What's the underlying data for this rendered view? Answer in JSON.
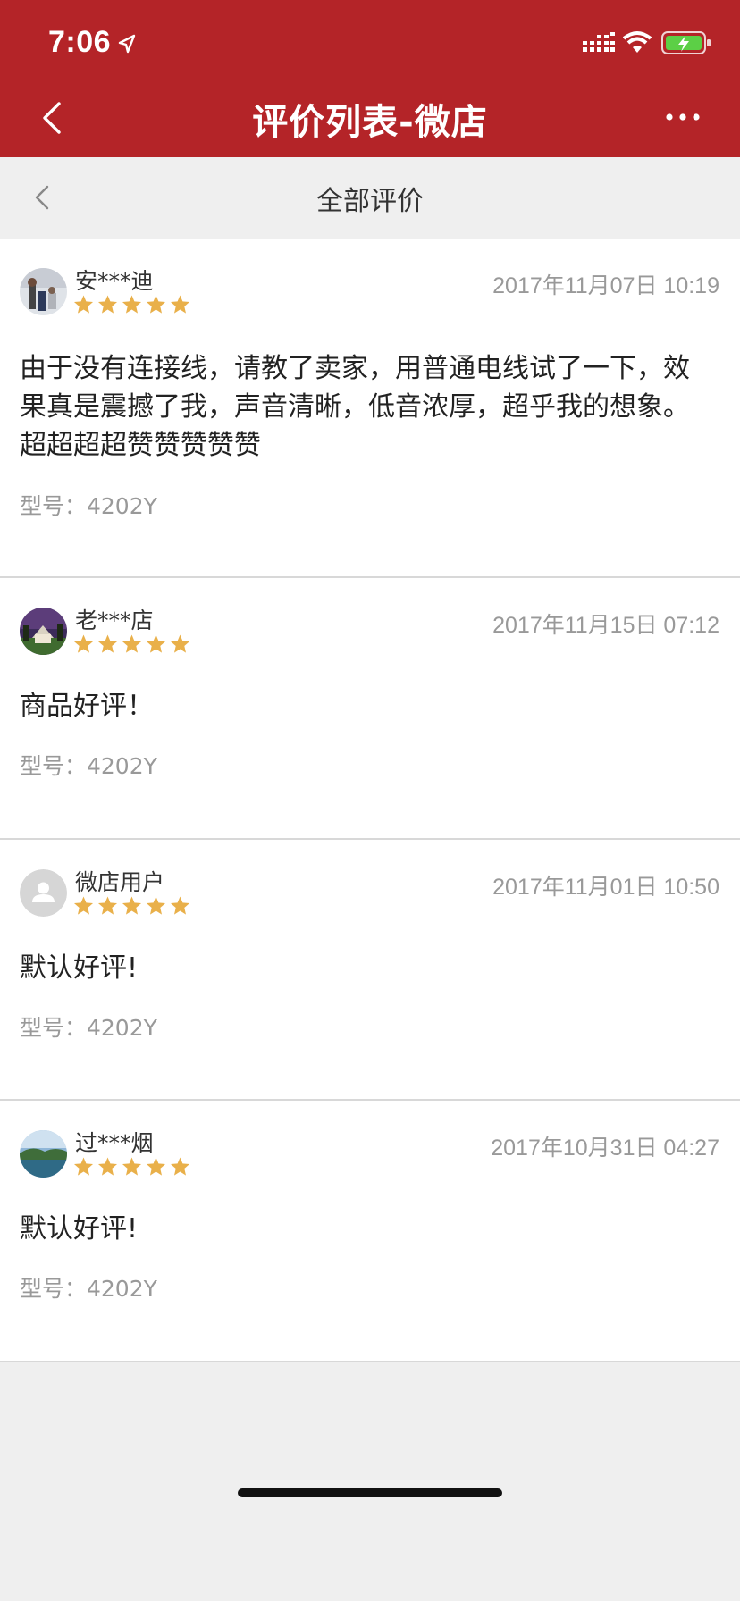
{
  "status": {
    "time": "7:06"
  },
  "nav": {
    "title": "评价列表-微店"
  },
  "subnav": {
    "title": "全部评价"
  },
  "colors": {
    "brand": "#b42428",
    "star": "#e9b04a"
  },
  "reviews": [
    {
      "user": "安***迪",
      "rating": 5,
      "date": "2017年11月07日 10:19",
      "text": "由于没有连接线，请教了卖家，用普通电线试了一下，效果真是震撼了我，声音清晰，低音浓厚，超乎我的想象。超超超超赞赞赞赞赞",
      "model": "型号：4202Y"
    },
    {
      "user": "老***店",
      "rating": 5,
      "date": "2017年11月15日 07:12",
      "text": "商品好评！",
      "model": "型号：4202Y"
    },
    {
      "user": "微店用户",
      "rating": 5,
      "date": "2017年11月01日 10:50",
      "text": "默认好评!",
      "model": "型号：4202Y"
    },
    {
      "user": "过***烟",
      "rating": 5,
      "date": "2017年10月31日 04:27",
      "text": "默认好评!",
      "model": "型号：4202Y"
    }
  ]
}
